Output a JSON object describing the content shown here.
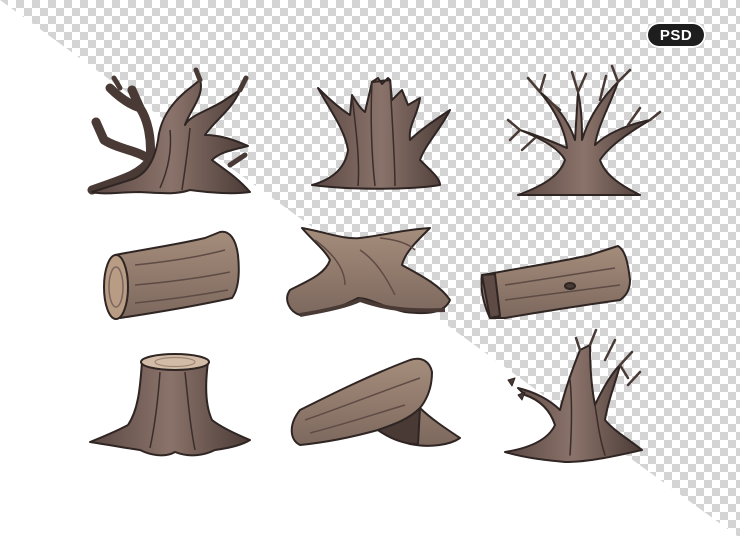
{
  "badge": {
    "label": "PSD"
  },
  "colors": {
    "bark_dark": "#4a3a36",
    "bark_mid": "#7a6560",
    "bark_light": "#9d8676",
    "wood_face": "#b89c84",
    "outline": "#2f2523",
    "checker_light": "#ffffff",
    "checker_dark": "#d4d4d4"
  },
  "items": [
    {
      "name": "gnarled-dead-tree-icon"
    },
    {
      "name": "broken-tree-stump-icon"
    },
    {
      "name": "bare-tree-icon"
    },
    {
      "name": "log-icon"
    },
    {
      "name": "driftwood-icon"
    },
    {
      "name": "flat-log-icon"
    },
    {
      "name": "cut-tree-stump-icon"
    },
    {
      "name": "split-driftwood-icon"
    },
    {
      "name": "broken-dead-tree-icon"
    }
  ]
}
